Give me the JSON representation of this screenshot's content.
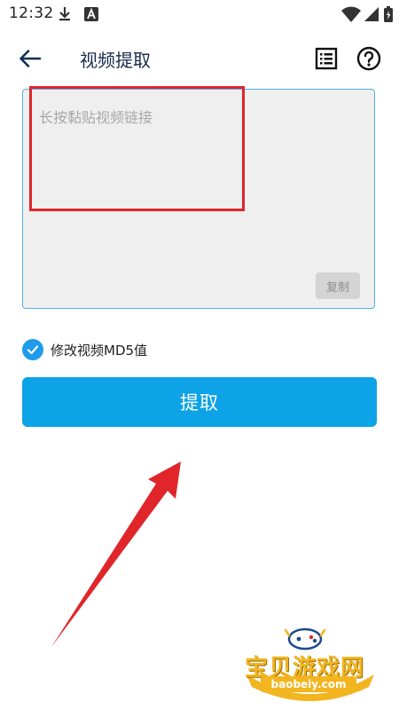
{
  "status_bar": {
    "time": "12:32",
    "icons": [
      "download-icon",
      "font-a-icon",
      "wifi-icon",
      "battery-icon"
    ]
  },
  "toolbar": {
    "title": "视频提取",
    "back_icon": "arrow-left-icon",
    "list_icon": "list-icon",
    "help_icon": "help-circle-icon"
  },
  "input": {
    "placeholder": "长按黏贴视频链接",
    "value": "",
    "copy_label": "复制"
  },
  "options": {
    "md5_label": "修改视频MD5值",
    "md5_checked": true
  },
  "actions": {
    "extract_label": "提取"
  },
  "watermark": {
    "name": "宝贝游戏网",
    "url": "baobeiy.com"
  },
  "colors": {
    "accent": "#0ea3e6",
    "input_border": "#4db3e6",
    "annotation_red": "#e0262a",
    "title": "#1b2a4a"
  }
}
